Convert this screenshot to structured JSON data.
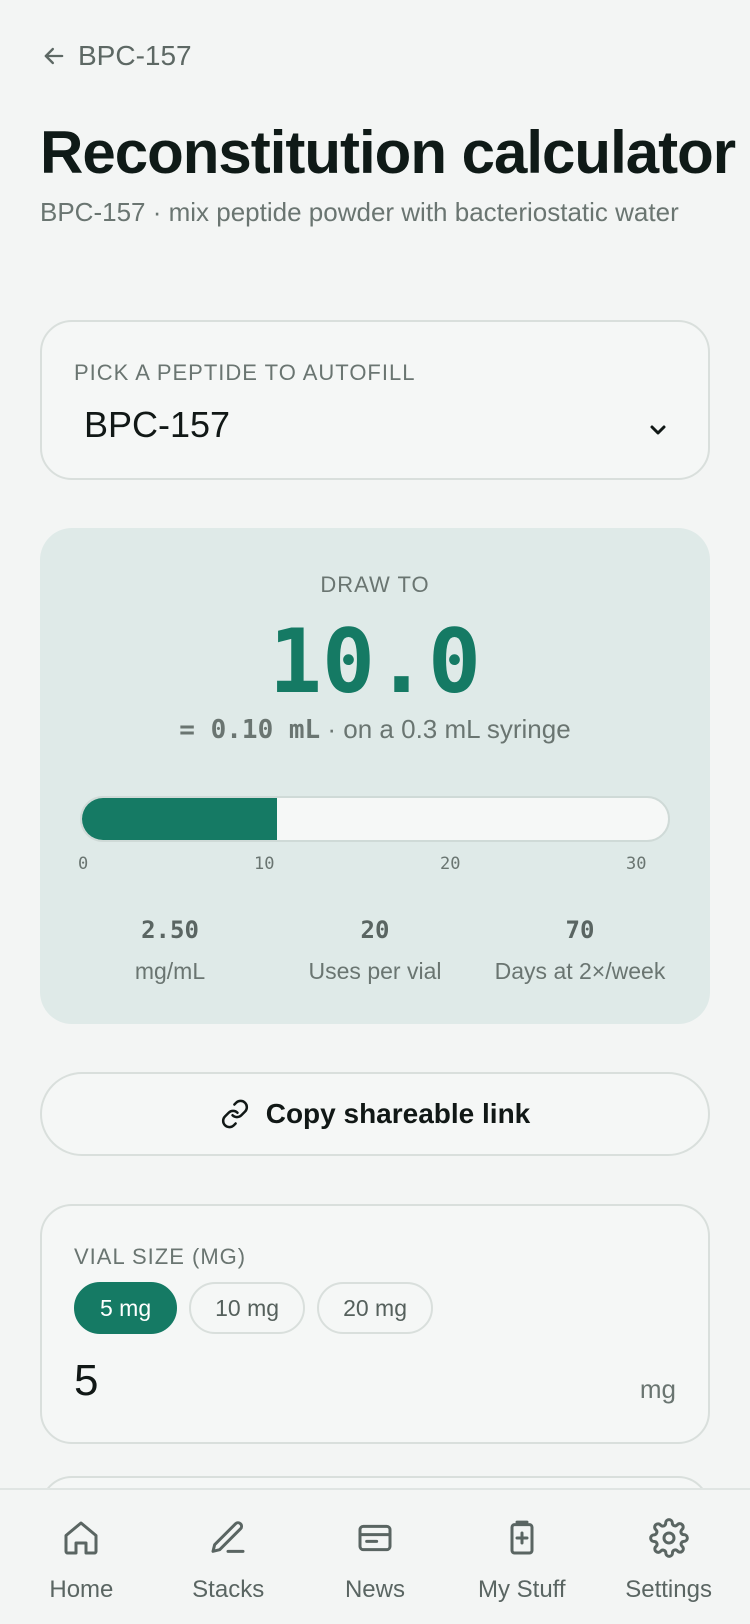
{
  "header": {
    "back_label": "BPC-157",
    "title": "Reconstitution calculator",
    "subtitle": "BPC-157 · mix peptide powder with bacteriostatic water"
  },
  "picker": {
    "label": "PICK A PEPTIDE TO AUTOFILL",
    "selected": "BPC-157"
  },
  "draw": {
    "label": "DRAW TO",
    "value": "10.0",
    "ml_text": "= 0.10 mL",
    "syringe_text": " · on a 0.3 mL syringe",
    "syringe_units_max": 30,
    "fill_units": 10,
    "ticks": [
      "0",
      "10",
      "20",
      "30"
    ],
    "stats": [
      {
        "value": "2.50",
        "label": "mg/mL"
      },
      {
        "value": "20",
        "label": "Uses per vial"
      },
      {
        "value": "70",
        "label": "Days at 2×/week"
      }
    ]
  },
  "copy_link": {
    "label": "Copy shareable link"
  },
  "vial": {
    "label": "VIAL SIZE (MG)",
    "chips": [
      "5 mg",
      "10 mg",
      "20 mg"
    ],
    "active_chip": 0,
    "input_value": "5",
    "unit": "mg"
  },
  "nav": [
    {
      "label": "Home",
      "icon": "home-icon"
    },
    {
      "label": "Stacks",
      "icon": "pen-icon"
    },
    {
      "label": "News",
      "icon": "news-icon"
    },
    {
      "label": "My Stuff",
      "icon": "my-stuff-icon"
    },
    {
      "label": "Settings",
      "icon": "gear-icon"
    }
  ],
  "colors": {
    "accent": "#157a64",
    "panel": "#dfeae8",
    "background": "#f3f5f4"
  }
}
